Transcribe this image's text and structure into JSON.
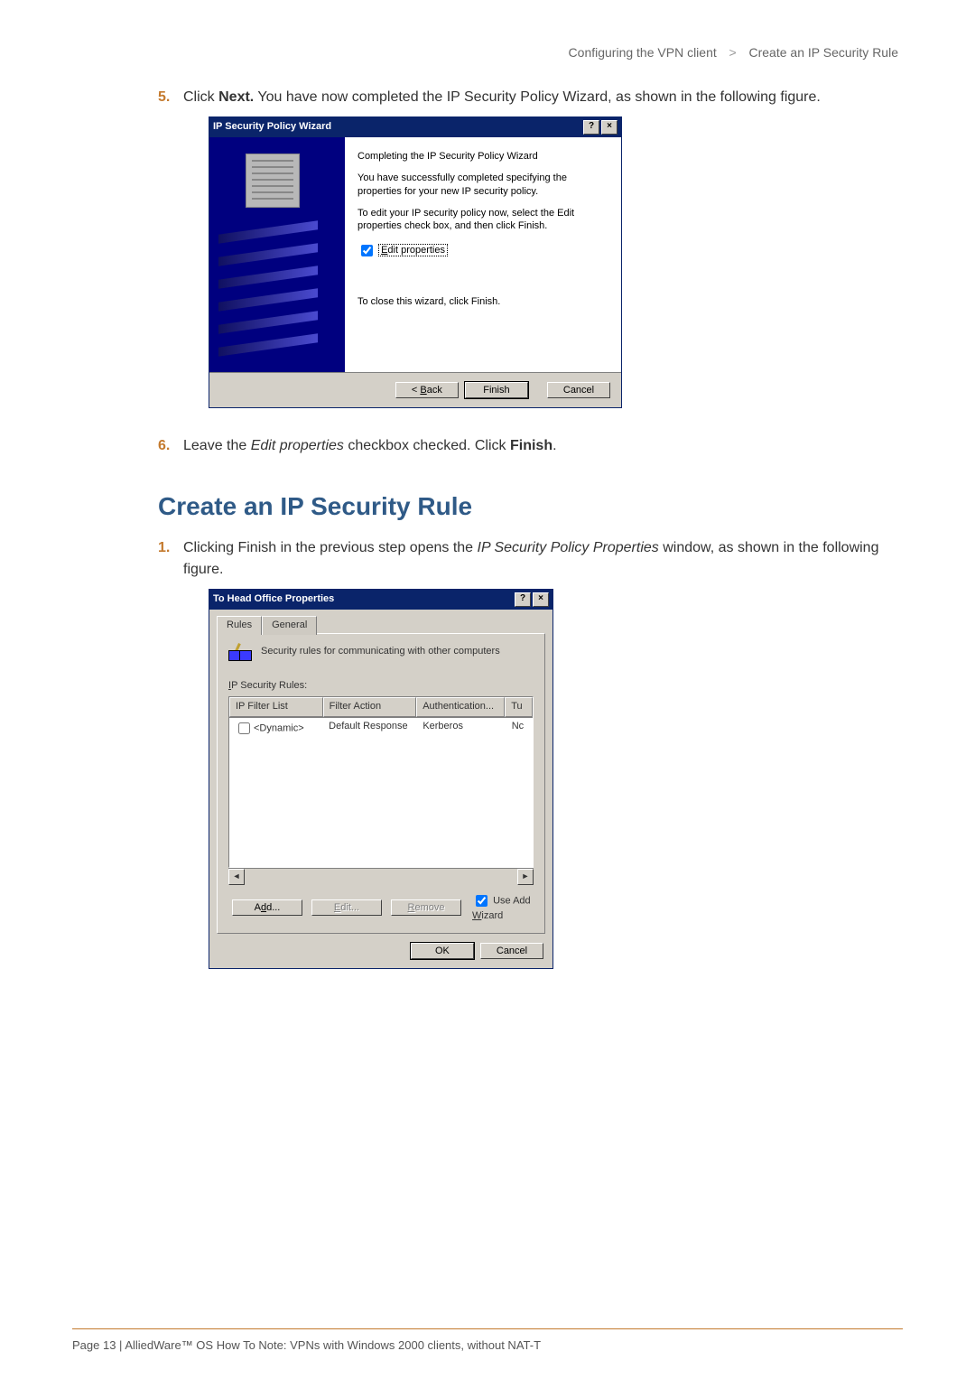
{
  "breadcrumb": {
    "section": "Configuring the VPN client",
    "page": "Create an IP Security Rule"
  },
  "steps_a": {
    "5": {
      "num": "5.",
      "pre": "Click ",
      "bold": "Next.",
      "post": " You have now completed the IP Security Policy Wizard, as shown in the following figure."
    }
  },
  "wizard": {
    "title": "IP Security Policy Wizard",
    "heading": "Completing the IP Security Policy Wizard",
    "p1": "You have successfully completed specifying the properties for your new IP security policy.",
    "p2": "To edit your IP security policy now, select the Edit properties check box, and then click Finish.",
    "chk_pre": "E",
    "chk_label": "dit properties",
    "p3": "To close this wizard, click Finish.",
    "btn_back_u": "B",
    "btn_back": "ack",
    "btn_back_pre": "< ",
    "btn_finish": "Finish",
    "btn_cancel": "Cancel",
    "help": "?",
    "close": "×"
  },
  "steps_b": {
    "6": {
      "num": "6.",
      "t1": "Leave the ",
      "i1": "Edit properties",
      "t2": " checkbox checked. Click ",
      "b1": "Finish",
      "t3": "."
    }
  },
  "heading2": "Create an IP Security Rule",
  "steps_c": {
    "1": {
      "num": "1.",
      "t1": "Clicking Finish in the previous step opens the ",
      "i1": "IP Security Policy Properties",
      "t2": " window, as shown in the following figure."
    }
  },
  "props": {
    "title": "To Head Office Properties",
    "tab1": "Rules",
    "tab2": "General",
    "desc": "Security rules for communicating with other computers",
    "listlabel_u": "I",
    "listlabel": "P Security Rules:",
    "col1": "IP Filter List",
    "col2": "Filter Action",
    "col3": "Authentication...",
    "col4": "Tu",
    "row1_c1": "<Dynamic>",
    "row1_c2": "Default Response",
    "row1_c3": "Kerberos",
    "row1_c4": "Nc",
    "btn_add_pre": "A",
    "btn_add_u": "d",
    "btn_add_post": "d...",
    "btn_edit_u": "E",
    "btn_edit": "dit...",
    "btn_remove_u": "R",
    "btn_remove": "emove",
    "wiz_label_pre": "Use Add ",
    "wiz_label_u": "W",
    "wiz_label_post": "izard",
    "btn_ok": "OK",
    "btn_cancel": "Cancel",
    "help": "?",
    "close": "×",
    "arr_l": "◄",
    "arr_r": "►"
  },
  "footer": "Page 13 | AlliedWare™ OS How To Note: VPNs with Windows 2000 clients, without NAT-T"
}
